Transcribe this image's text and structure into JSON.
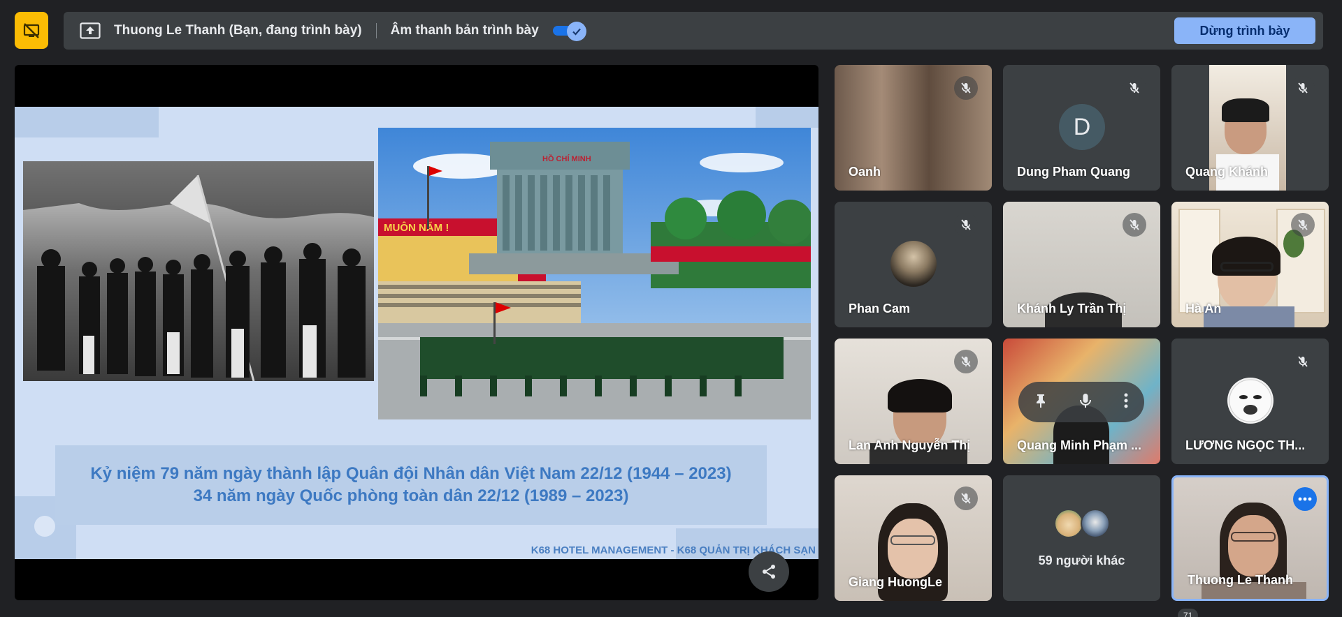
{
  "topbar": {
    "presenter_text": "Thuong Le Thanh (Bạn, đang trình bày)",
    "audio_label": "Âm thanh bản trình bày",
    "audio_toggle_on": true,
    "stop_button": "Dừng trình bày"
  },
  "slide": {
    "caption_line1": "Kỷ niệm 79 năm ngày thành lập Quân đội Nhân dân Việt Nam 22/12 (1944 – 2023)",
    "caption_line2": "34 năm ngày Quốc phòng toàn dân 22/12 (1989 – 2023)",
    "footer": "K68 HOTEL MANAGEMENT - K68 QUẢN TRỊ KHÁCH SẠN",
    "banner_text": "MUÔN NĂM !",
    "mausoleum_text": "HỒ CHÍ MINH"
  },
  "participants": [
    {
      "name": "Oanh",
      "muted": true
    },
    {
      "name": "Dung Pham Quang",
      "muted": true,
      "initial": "D"
    },
    {
      "name": "Quang Khánh",
      "muted": true
    },
    {
      "name": "Phan Cam",
      "muted": true
    },
    {
      "name": "Khánh Ly Trần Thị",
      "muted": true
    },
    {
      "name": "Hà An",
      "muted": true
    },
    {
      "name": "Lan Anh Nguyễn Thị",
      "muted": true
    },
    {
      "name": "Quang Minh Phạm ...",
      "muted": false
    },
    {
      "name": "LƯƠNG NGỌC TH...",
      "muted": true
    },
    {
      "name": "Giang HuongLe",
      "muted": true
    },
    {
      "name": "Thuong Le Thanh",
      "muted": false
    }
  ],
  "others": {
    "label": "59 người khác"
  },
  "participant_count": "71",
  "colors": {
    "accent": "#8ab4f8",
    "present_icon_bg": "#fbbc04",
    "tile_bg": "#3c4043",
    "page_bg": "#202124"
  }
}
